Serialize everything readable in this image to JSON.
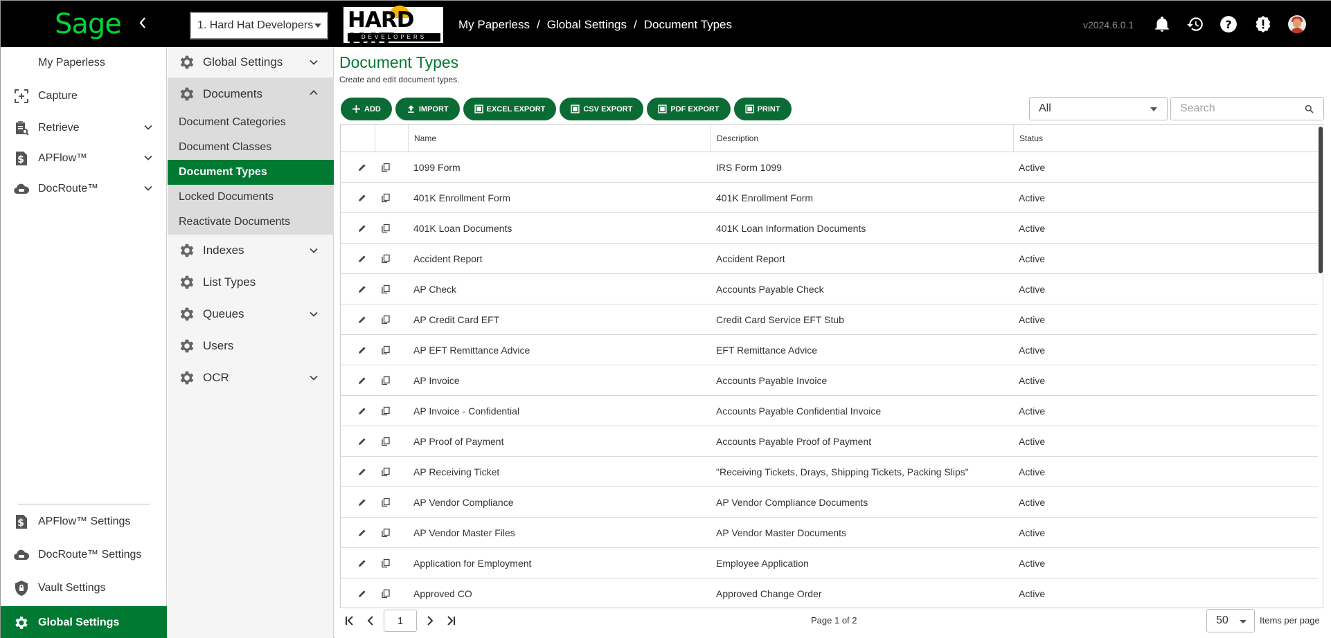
{
  "topbar": {
    "brand": "Sage",
    "company": "1. Hard Hat Developers",
    "partner_logo": {
      "main": "HARD HAT",
      "sub": "DEVELOPERS"
    },
    "breadcrumb": [
      "My Paperless",
      "Global Settings",
      "Document Types"
    ],
    "version": "v2024.6.0.1",
    "icons": [
      "bell-icon",
      "history-icon",
      "help-icon",
      "alert-icon",
      "user-avatar"
    ]
  },
  "sidebar": {
    "top_items": [
      {
        "label": "My Paperless",
        "icon": "home-icon",
        "expandable": false
      },
      {
        "label": "Capture",
        "icon": "capture-icon",
        "expandable": false
      },
      {
        "label": "Retrieve",
        "icon": "clipboard-search-icon",
        "expandable": true
      },
      {
        "label": "APFlow™",
        "icon": "dollar-doc-icon",
        "expandable": true
      },
      {
        "label": "DocRoute™",
        "icon": "cloud-icon",
        "expandable": true
      }
    ],
    "bottom_items": [
      {
        "label": "APFlow™ Settings",
        "icon": "dollar-doc-icon"
      },
      {
        "label": "DocRoute™ Settings",
        "icon": "cloud-icon"
      },
      {
        "label": "Vault Settings",
        "icon": "shield-lock-icon"
      },
      {
        "label": "Global Settings",
        "icon": "gear-icon",
        "active": true
      }
    ]
  },
  "subnav": {
    "sections": [
      {
        "label": "Global Settings",
        "expandable": true
      },
      {
        "label": "Documents",
        "expandable": true,
        "open": true
      },
      {
        "label": "Indexes",
        "expandable": true
      },
      {
        "label": "List Types",
        "expandable": false
      },
      {
        "label": "Queues",
        "expandable": true
      },
      {
        "label": "Users",
        "expandable": false
      },
      {
        "label": "OCR",
        "expandable": true
      }
    ],
    "documents_children": [
      {
        "label": "Document Categories"
      },
      {
        "label": "Document Classes"
      },
      {
        "label": "Document Types",
        "active": true
      },
      {
        "label": "Locked Documents"
      },
      {
        "label": "Reactivate Documents"
      }
    ]
  },
  "main": {
    "title": "Document Types",
    "subtitle": "Create and edit document types.",
    "toolbar": {
      "add": "ADD",
      "import": "IMPORT",
      "excel_export": "EXCEL EXPORT",
      "csv_export": "CSV EXPORT",
      "pdf_export": "PDF EXPORT",
      "print": "PRINT"
    },
    "filter_value": "All",
    "search_placeholder": "Search"
  },
  "table": {
    "columns": [
      "Name",
      "Description",
      "Status"
    ],
    "rows": [
      {
        "name": "1099 Form",
        "description": "IRS Form 1099",
        "status": "Active"
      },
      {
        "name": "401K Enrollment Form",
        "description": "401K Enrollment Form",
        "status": "Active"
      },
      {
        "name": "401K Loan Documents",
        "description": "401K Loan Information Documents",
        "status": "Active"
      },
      {
        "name": "Accident Report",
        "description": "Accident Report",
        "status": "Active"
      },
      {
        "name": "AP Check",
        "description": "Accounts Payable Check",
        "status": "Active"
      },
      {
        "name": "AP Credit Card EFT",
        "description": "Credit Card Service EFT Stub",
        "status": "Active"
      },
      {
        "name": "AP EFT Remittance Advice",
        "description": "EFT Remittance Advice",
        "status": "Active"
      },
      {
        "name": "AP Invoice",
        "description": "Accounts Payable Invoice",
        "status": "Active"
      },
      {
        "name": "AP Invoice - Confidential",
        "description": "Accounts Payable Confidential Invoice",
        "status": "Active"
      },
      {
        "name": "AP Proof of Payment",
        "description": "Accounts Payable Proof of Payment",
        "status": "Active"
      },
      {
        "name": "AP Receiving Ticket",
        "description": "\"Receiving Tickets, Drays, Shipping Tickets, Packing Slips\"",
        "status": "Active"
      },
      {
        "name": "AP Vendor Compliance",
        "description": "AP Vendor Compliance Documents",
        "status": "Active"
      },
      {
        "name": "AP Vendor Master Files",
        "description": "AP Vendor Master Documents",
        "status": "Active"
      },
      {
        "name": "Application for Employment",
        "description": "Employee Application",
        "status": "Active"
      },
      {
        "name": "Approved CO",
        "description": "Approved Change Order",
        "status": "Active"
      }
    ]
  },
  "pager": {
    "current_page": "1",
    "page_info": "Page 1 of 2",
    "per_page": "50",
    "per_page_label": "Items per page"
  },
  "colors": {
    "accent": "#007a33",
    "button": "#0b6b34",
    "brand_green": "#00d639"
  }
}
